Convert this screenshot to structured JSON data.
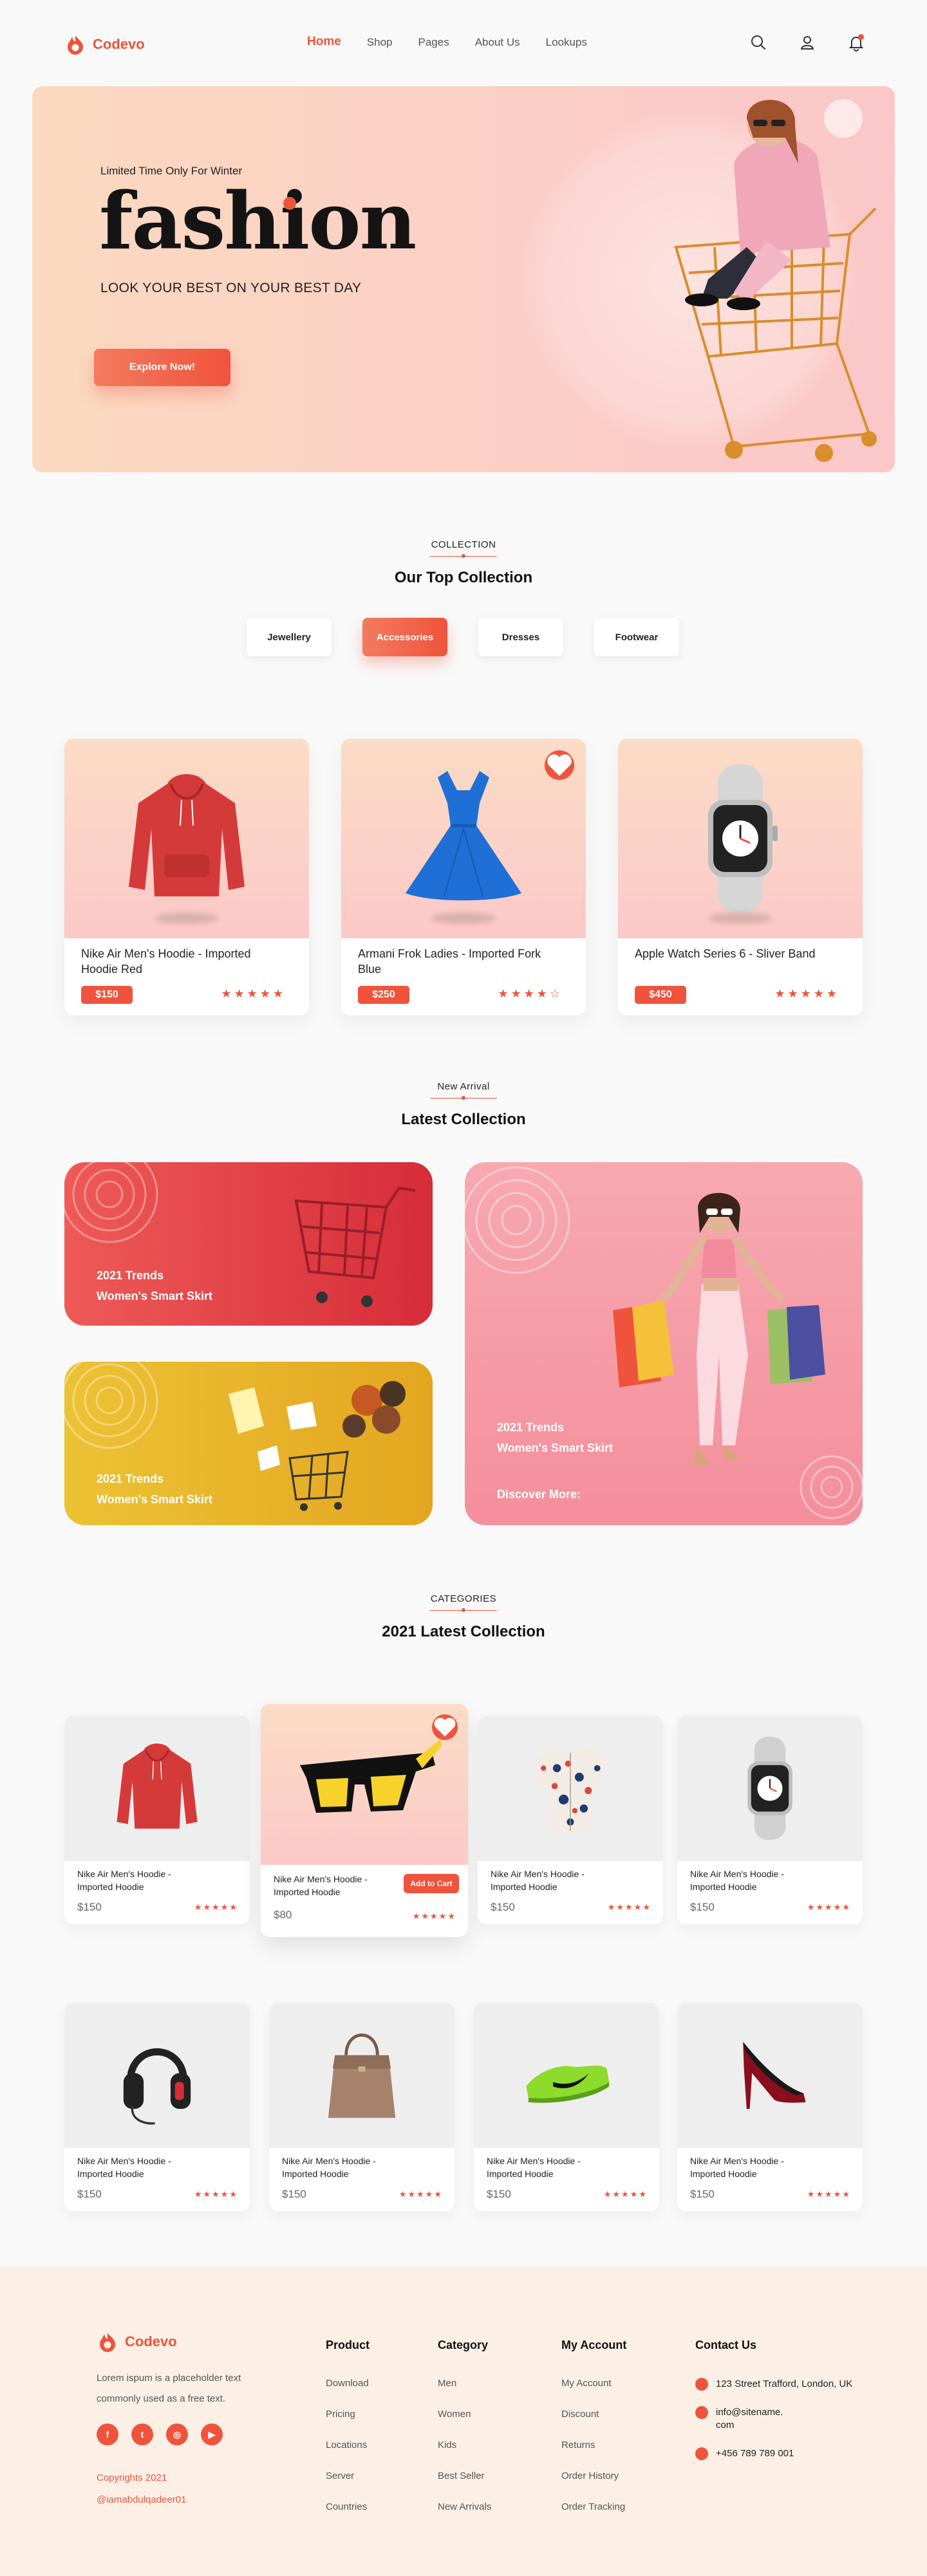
{
  "brand": {
    "name": "Codevo",
    "accent": "#f0533b"
  },
  "nav": {
    "items": [
      "Home",
      "Shop",
      "Pages",
      "About Us",
      "Lookups"
    ],
    "icons": [
      "search-icon",
      "user-icon",
      "bell-icon"
    ]
  },
  "hero": {
    "subtitle": "Limited Time Only For Winter",
    "title": "fashion",
    "tagline": "LOOK YOUR BEST ON YOUR BEST DAY",
    "button": "Explore Now!"
  },
  "collection": {
    "label": "COLLECTION",
    "title": "Our Top Collection",
    "tabs": [
      "Jewellery",
      "Accessories",
      "Dresses",
      "Footwear"
    ],
    "active_tab": "Accessories",
    "products": [
      {
        "name": "Nike Air Men's Hoodie -  Imported Hoodie Red",
        "price": "$150",
        "stars": "★★★★★",
        "icon": "hoodie-icon"
      },
      {
        "name": "Armani Frok Ladies -  Imported Fork Blue",
        "price": "$250",
        "stars": "★★★★☆",
        "icon": "dress-icon"
      },
      {
        "name": "Apple Watch Series 6 - Sliver Band",
        "price": "$450",
        "stars": "★★★★★",
        "icon": "watch-icon"
      }
    ]
  },
  "latest": {
    "label": "New Arrival",
    "title": "Latest Collection",
    "banners": [
      {
        "line1": "2021 Trends",
        "line2": "Women's Smart Skirt",
        "color": "#e8403f"
      },
      {
        "line1": "2021 Trends",
        "line2": "Women's Smart Skirt",
        "color": "#e9b72a"
      },
      {
        "line1": "2021 Trends",
        "line2": "Women's Smart Skirt",
        "cta": "Discover More:",
        "color": "#f5a3ab"
      }
    ]
  },
  "categories": {
    "label": "CATEGORIES",
    "title": "2021 Latest Collection",
    "add_to_cart": "Add to Cart",
    "items": [
      {
        "name": "Nike Air Men's Hoodie - Imported Hoodie",
        "price": "$150",
        "stars": "★★★★★",
        "icon": "hoodie-icon"
      },
      {
        "name": "Nike Air Men's Hoodie - Imported Hoodie",
        "price": "$80",
        "stars": "★★★★★",
        "icon": "glasses-icon"
      },
      {
        "name": "Nike Air Men's Hoodie - Imported Hoodie",
        "price": "$150",
        "stars": "★★★★★",
        "icon": "shirt-icon"
      },
      {
        "name": "Nike Air Men's Hoodie - Imported Hoodie",
        "price": "$150",
        "stars": "★★★★★",
        "icon": "watch-icon"
      },
      {
        "name": "Nike Air Men's Hoodie - Imported Hoodie",
        "price": "$150",
        "stars": "★★★★★",
        "icon": "headphones-icon"
      },
      {
        "name": "Nike Air Men's Hoodie - Imported Hoodie",
        "price": "$150",
        "stars": "★★★★★",
        "icon": "handbag-icon"
      },
      {
        "name": "Nike Air Men's Hoodie - Imported Hoodie",
        "price": "$150",
        "stars": "★★★★★",
        "icon": "sneaker-icon"
      },
      {
        "name": "Nike Air Men's Hoodie - Imported Hoodie",
        "price": "$150",
        "stars": "★★★★★",
        "icon": "heel-icon"
      }
    ]
  },
  "footer": {
    "brand": "Codevo",
    "description": "Lorem ispum is a placeholder text commonly used as a free text.",
    "copyright": "Copyrights 2021",
    "handle": "@iamabdulqadeer01",
    "socials": [
      "f",
      "t",
      "ig",
      "yt"
    ],
    "columns": [
      {
        "title": "Product",
        "links": [
          "Download",
          "Pricing",
          "Locations",
          "Server",
          "Countries"
        ]
      },
      {
        "title": "Category",
        "links": [
          "Men",
          "Women",
          "Kids",
          "Best Seller",
          "New Arrivals"
        ]
      },
      {
        "title": "My Account",
        "links": [
          "My Account",
          "Discount",
          "Returns",
          "Order History",
          "Order Tracking"
        ]
      }
    ],
    "contact": {
      "title": "Contact Us",
      "address": "123 Street Trafford, London, UK",
      "email": "info@sitename. com",
      "phone": "+456 789 789 001"
    }
  }
}
